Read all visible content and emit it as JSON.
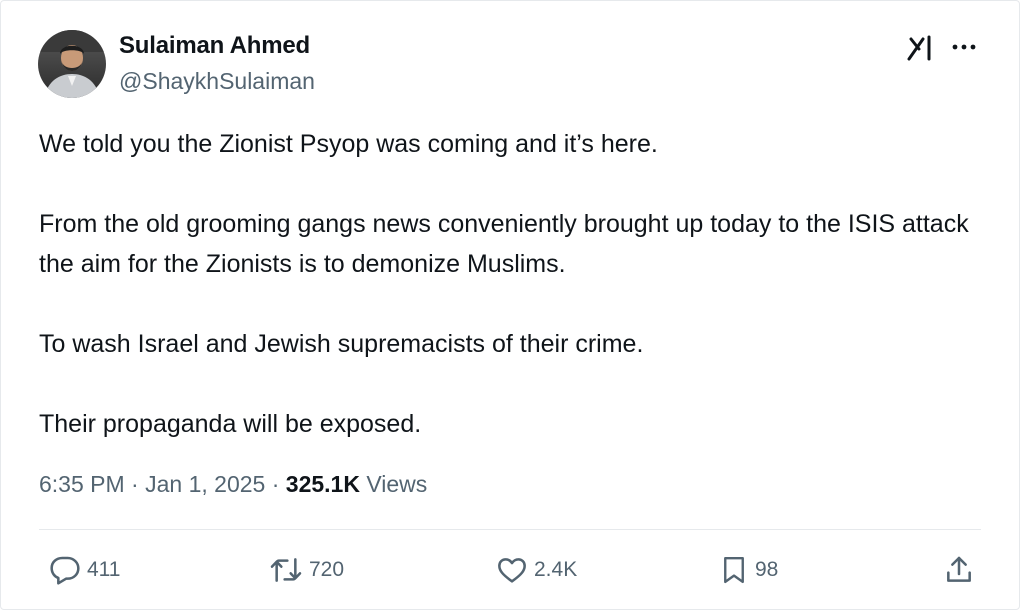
{
  "author": {
    "display_name": "Sulaiman Ahmed",
    "handle": "@ShaykhSulaiman"
  },
  "tweet": {
    "paragraphs": [
      "We told you the Zionist Psyop was coming and it’s here.",
      "From the old grooming gangs news conveniently brought up today to the ISIS attack the aim for the Zionists is to demonize Muslims.",
      "To wash Israel and Jewish supremacists of their crime.",
      "Their propaganda will be exposed."
    ]
  },
  "meta": {
    "time": "6:35 PM",
    "separator": " · ",
    "date": "Jan 1, 2025",
    "views_count": "325.1K",
    "views_label": "Views"
  },
  "actions": {
    "replies": "411",
    "reposts": "720",
    "likes": "2.4K",
    "bookmarks": "98"
  },
  "icons": {
    "top_right": [
      "grok-icon",
      "more-icon"
    ],
    "actions": [
      "reply-icon",
      "repost-icon",
      "like-icon",
      "bookmark-icon",
      "share-icon"
    ]
  },
  "colors": {
    "text_primary": "#0f1419",
    "text_secondary": "#536471",
    "border": "#e6e9ec"
  }
}
